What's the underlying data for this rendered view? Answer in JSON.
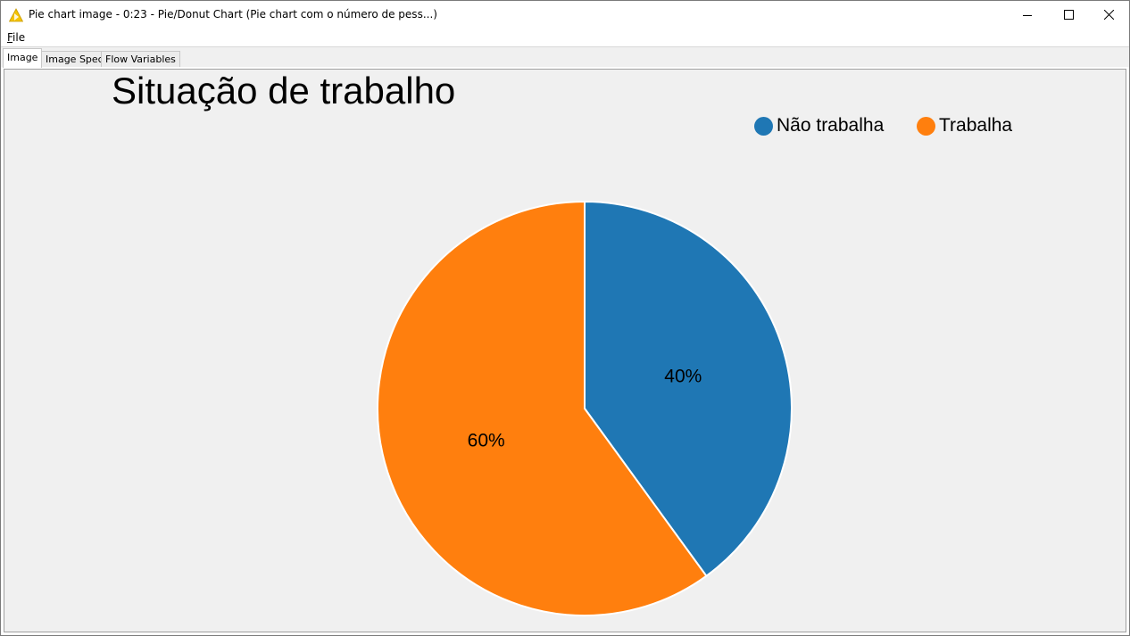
{
  "window": {
    "title": "Pie chart image - 0:23 - Pie/Donut Chart (Pie chart com o número de pess...)",
    "icon": "knime-warning-triangle-icon"
  },
  "menu": {
    "file_label_accel": "F",
    "file_label_rest": "ile"
  },
  "tabs": [
    {
      "label": "Image",
      "active": true
    },
    {
      "label": "Image Spec",
      "active": false
    },
    {
      "label": "Flow Variables",
      "active": false
    }
  ],
  "chart_data": {
    "type": "pie",
    "title": "Situação de trabalho",
    "legend_position": "top-right",
    "slices": [
      {
        "label": "Não trabalha",
        "value": 40,
        "display": "40%",
        "color": "#1f77b4"
      },
      {
        "label": "Trabalha",
        "value": 60,
        "display": "60%",
        "color": "#ff7f0e"
      }
    ]
  }
}
